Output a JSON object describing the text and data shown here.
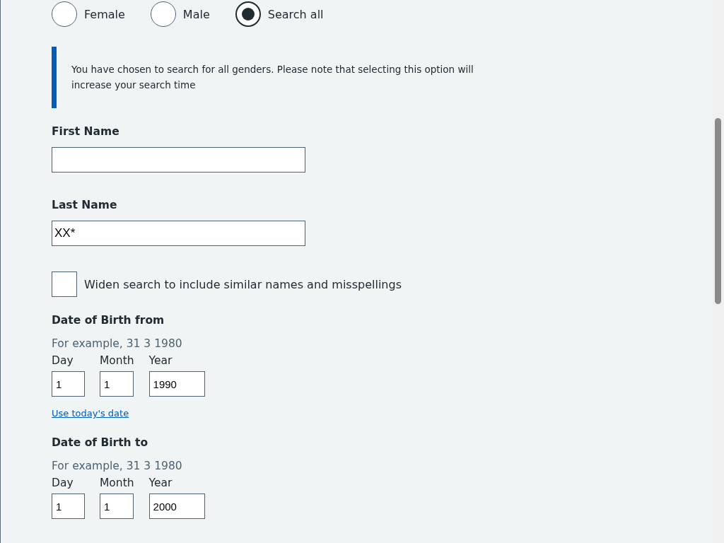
{
  "gender_options": [
    {
      "label": "Female",
      "selected": false
    },
    {
      "label": "Male",
      "selected": false
    },
    {
      "label": "Search all",
      "selected": true
    }
  ],
  "inset_text": "You have chosen to search for all genders. Please note that selecting this option will increase your search time",
  "first_name": {
    "label": "First Name"
  },
  "last_name": {
    "label": "Last Name",
    "value": "XX*"
  },
  "widen_search": {
    "label": "Widen search to include similar names and misspellings",
    "checked": false
  },
  "date_groups": [
    {
      "label": "Date of Birth from",
      "hint": "For example, 31 3 1980",
      "fields": [
        {
          "label": "Day",
          "value": "1"
        },
        {
          "label": "Month",
          "value": "1"
        },
        {
          "label": "Year",
          "value": "1990"
        }
      ],
      "link": "Use today's date"
    },
    {
      "label": "Date of Birth to",
      "hint": "For example, 31 3 1980",
      "fields": [
        {
          "label": "Day",
          "value": "1"
        },
        {
          "label": "Month",
          "value": "1"
        },
        {
          "label": "Year",
          "value": "2000"
        }
      ]
    }
  ]
}
